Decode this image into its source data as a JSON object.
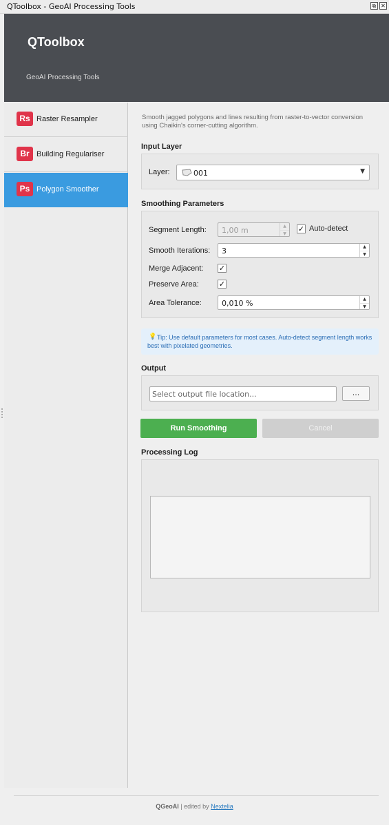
{
  "window": {
    "title": "QToolbox - GeoAI Processing Tools",
    "float_icon": "⧉",
    "close_icon": "✕"
  },
  "header": {
    "title": "QToolbox",
    "subtitle": "GeoAI Processing Tools"
  },
  "sidebar": {
    "items": [
      {
        "badge": "Rs",
        "label": "Raster Resampler",
        "active": false
      },
      {
        "badge": "Br",
        "label": "Building Regulariser",
        "active": false
      },
      {
        "badge": "Ps",
        "label": "Polygon Smoother",
        "active": true
      }
    ]
  },
  "main": {
    "description": "Smooth jagged polygons and lines resulting from raster-to-vector conversion using Chaikin's corner-cutting algorithm.",
    "input": {
      "section_title": "Input Layer",
      "layer_label": "Layer:",
      "layer_value": "001"
    },
    "params": {
      "section_title": "Smoothing Parameters",
      "segment_length_label": "Segment Length:",
      "segment_length_value": "1,00 m",
      "auto_detect_label": "Auto-detect",
      "auto_detect_checked": true,
      "smooth_iterations_label": "Smooth Iterations:",
      "smooth_iterations_value": "3",
      "merge_adjacent_label": "Merge Adjacent:",
      "merge_adjacent_checked": true,
      "preserve_area_label": "Preserve Area:",
      "preserve_area_checked": true,
      "area_tolerance_label": "Area Tolerance:",
      "area_tolerance_value": "0,010 %"
    },
    "tip": {
      "text": "Tip: Use default parameters for most cases. Auto-detect segment length works best with pixelated geometries."
    },
    "output": {
      "section_title": "Output",
      "placeholder": "Select output file location...",
      "browse_label": "..."
    },
    "actions": {
      "run_label": "Run Smoothing",
      "cancel_label": "Cancel"
    },
    "log": {
      "section_title": "Processing Log"
    }
  },
  "footer": {
    "brand": "QGeoAI",
    "separator": "|",
    "edited_by": "edited by",
    "link": "Nextelia"
  },
  "colors": {
    "accent": "#3a9be0",
    "badge": "#e0344a",
    "run": "#4caf50",
    "header": "#4a4d52"
  }
}
